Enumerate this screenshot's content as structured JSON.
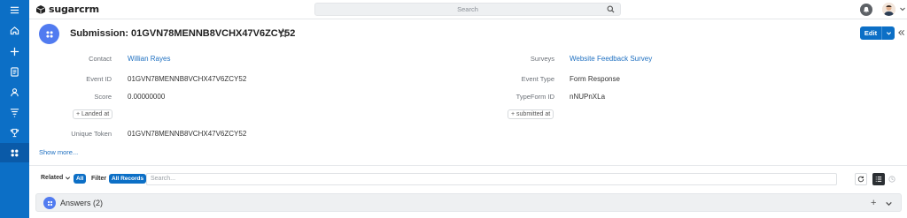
{
  "app": {
    "brand": "sugarcrm"
  },
  "search": {
    "placeholder": "Search"
  },
  "record": {
    "title": "Submission: 01GVN78MENNB8VCHX47V6ZCY52",
    "edit_label": "Edit"
  },
  "fields": {
    "contact_label": "Contact",
    "contact_value": "Willian Rayes",
    "surveys_label": "Surveys",
    "surveys_value": "Website Feedback Survey",
    "event_id_label": "Event ID",
    "event_id_value": "01GVN78MENNB8VCHX47V6ZCY52",
    "event_type_label": "Event Type",
    "event_type_value": "Form Response",
    "score_label": "Score",
    "score_value": "0.00000000",
    "typeform_id_label": "TypeForm ID",
    "typeform_id_value": "nNUPnXLa",
    "landed_at_pill": "+ Landed at",
    "submitted_at_pill": "+ submitted at",
    "unique_token_label": "Unique Token",
    "unique_token_value": "01GVN78MENNB8VCHX47V6ZCY52",
    "show_more": "Show more..."
  },
  "subpanel_toolbar": {
    "related_label": "Related",
    "related_badge": "All",
    "filter_label": "Filter",
    "filter_badge": "All Records",
    "search_placeholder": "Search..."
  },
  "answers": {
    "title": "Answers (2)",
    "add": "+"
  },
  "colors": {
    "nav": "#0c6fc6",
    "accent": "#517bf0",
    "link": "#1f70c1"
  },
  "nav_icons": [
    "menu-icon",
    "home-icon",
    "plus-icon",
    "document-icon",
    "contacts-icon",
    "filter-icon",
    "trophy-icon",
    "apps-icon"
  ]
}
